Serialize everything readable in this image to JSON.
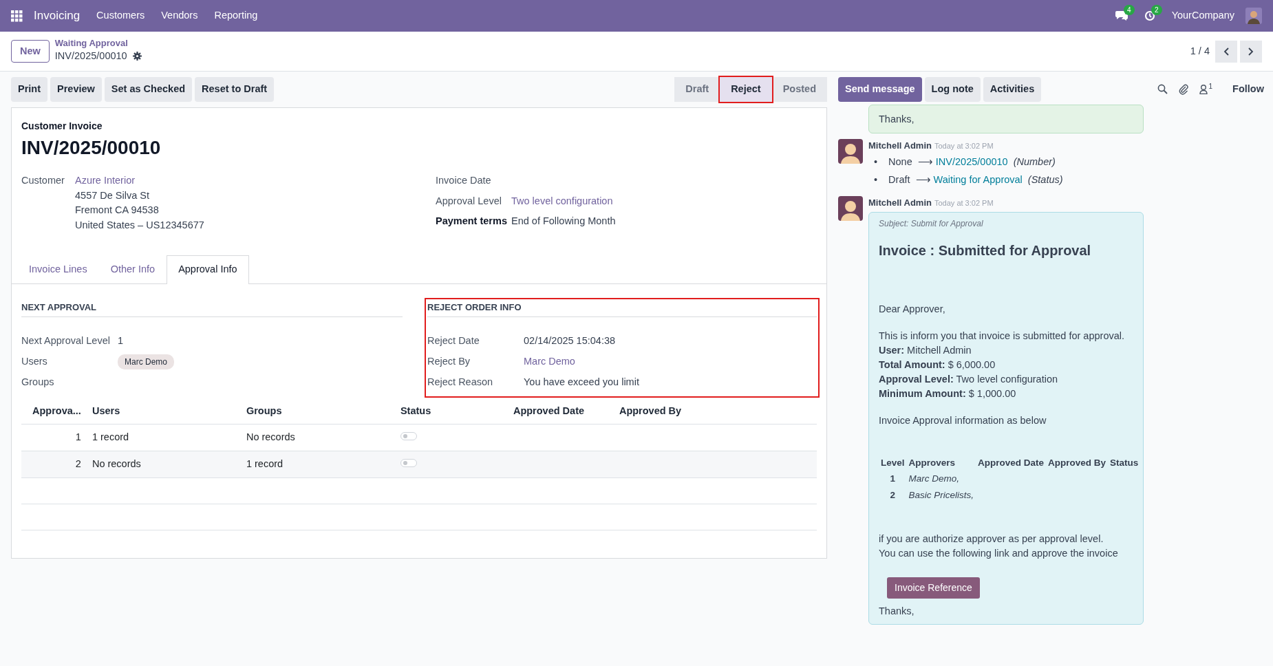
{
  "navbar": {
    "app": "Invoicing",
    "menu": [
      "Customers",
      "Vendors",
      "Reporting"
    ],
    "messages_count": "4",
    "activities_count": "2",
    "company": "YourCompany"
  },
  "control_panel": {
    "new_button": "New",
    "breadcrumb": "Waiting Approval",
    "record": "INV/2025/00010",
    "pager": "1 / 4"
  },
  "actions": [
    "Print",
    "Preview",
    "Set as Checked",
    "Reset to Draft"
  ],
  "status_stages": [
    {
      "label": "Draft",
      "selected": false,
      "highlighted": false
    },
    {
      "label": "Reject",
      "selected": true,
      "highlighted": true
    },
    {
      "label": "Posted",
      "selected": false,
      "highlighted": false
    }
  ],
  "chatter_actions": [
    {
      "label": "Send message",
      "selected": true
    },
    {
      "label": "Log note",
      "selected": false
    },
    {
      "label": "Activities",
      "selected": false
    }
  ],
  "followers_count": "1",
  "follow": "Follow",
  "form": {
    "type_label": "Customer Invoice",
    "number": "INV/2025/00010",
    "left_fields": [
      {
        "label": "Customer",
        "kind": "link",
        "value": "Azure Interior",
        "address": [
          "4557 De Silva St",
          "Fremont CA 94538",
          "United States – US12345677"
        ],
        "emphasis": false
      }
    ],
    "right_fields": [
      {
        "label": "Invoice Date",
        "kind": "empty",
        "emphasis": false
      },
      {
        "label": "Approval Level",
        "kind": "link",
        "value": "Two level configuration",
        "emphasis": false
      },
      {
        "label": "Payment terms",
        "kind": "text",
        "value": "End of Following Month",
        "emphasis": true
      }
    ],
    "tabs": [
      {
        "label": "Invoice Lines",
        "selected": false
      },
      {
        "label": "Other Info",
        "selected": false
      },
      {
        "label": "Approval Info",
        "selected": true
      }
    ],
    "next_approval": {
      "title": "NEXT APPROVAL",
      "fields": [
        {
          "label": "Next Approval Level",
          "kind": "text",
          "value": "1"
        },
        {
          "label": "Users",
          "kind": "tag",
          "value": "Marc Demo"
        },
        {
          "label": "Groups",
          "kind": "empty"
        }
      ]
    },
    "reject_info": {
      "title": "REJECT ORDER INFO",
      "highlighted": true,
      "fields": [
        {
          "label": "Reject Date",
          "kind": "text",
          "value": "02/14/2025 15:04:38"
        },
        {
          "label": "Reject By",
          "kind": "link",
          "value": "Marc Demo"
        },
        {
          "label": "Reject Reason",
          "kind": "text",
          "value": "You have exceed you limit"
        }
      ]
    },
    "approvals_table": {
      "columns": [
        "Approva...",
        "Users",
        "Groups",
        "Status",
        "Approved Date",
        "Approved By"
      ],
      "rows": [
        {
          "level": "1",
          "users": "1 record",
          "groups": "No records",
          "on": false
        },
        {
          "level": "2",
          "users": "No records",
          "groups": "1 record",
          "on": false
        }
      ]
    }
  },
  "chatter": [
    {
      "kind": "partial",
      "color": "#e4f3e6",
      "closing": "Thanks,"
    },
    {
      "kind": "tracking",
      "author": "Mitchell Admin",
      "time": "Today at 3:02 PM",
      "changes": [
        {
          "bullet": "•",
          "old": "None",
          "arrow": "⟶",
          "new": "INV/2025/00010",
          "field": "(Number)"
        },
        {
          "bullet": "•",
          "old": "Draft",
          "arrow": "⟶",
          "new": "Waiting for Approval",
          "field": "(Status)"
        }
      ]
    },
    {
      "kind": "email",
      "color": "#e1f3f6",
      "author": "Mitchell Admin",
      "time": "Today at 3:02 PM",
      "subject": "Subject: Submit for Approval",
      "heading": "Invoice : Submitted for Approval",
      "greeting": "Dear Approver,",
      "details": [
        "This is inform you that invoice is submitted for approval.",
        "**User:** Mitchell Admin",
        "**Total Amount:** $ 6,000.00",
        "**Approval Level:** Two level configuration",
        "**Minimum Amount:** $ 1,000.00"
      ],
      "intro": "Invoice Approval information as below",
      "table_columns": [
        "Level",
        "Approvers",
        "Approved Date",
        "Approved By",
        "Status"
      ],
      "table_rows": [
        {
          "level": "1",
          "approvers": "Marc Demo,"
        },
        {
          "level": "2",
          "approvers": "Basic Pricelists,"
        }
      ],
      "closing_lines": [
        "if you are authorize approver as per approval level.",
        "You can use the following link and approve the invoice"
      ],
      "button": "Invoice Reference",
      "closing": "Thanks,"
    }
  ]
}
